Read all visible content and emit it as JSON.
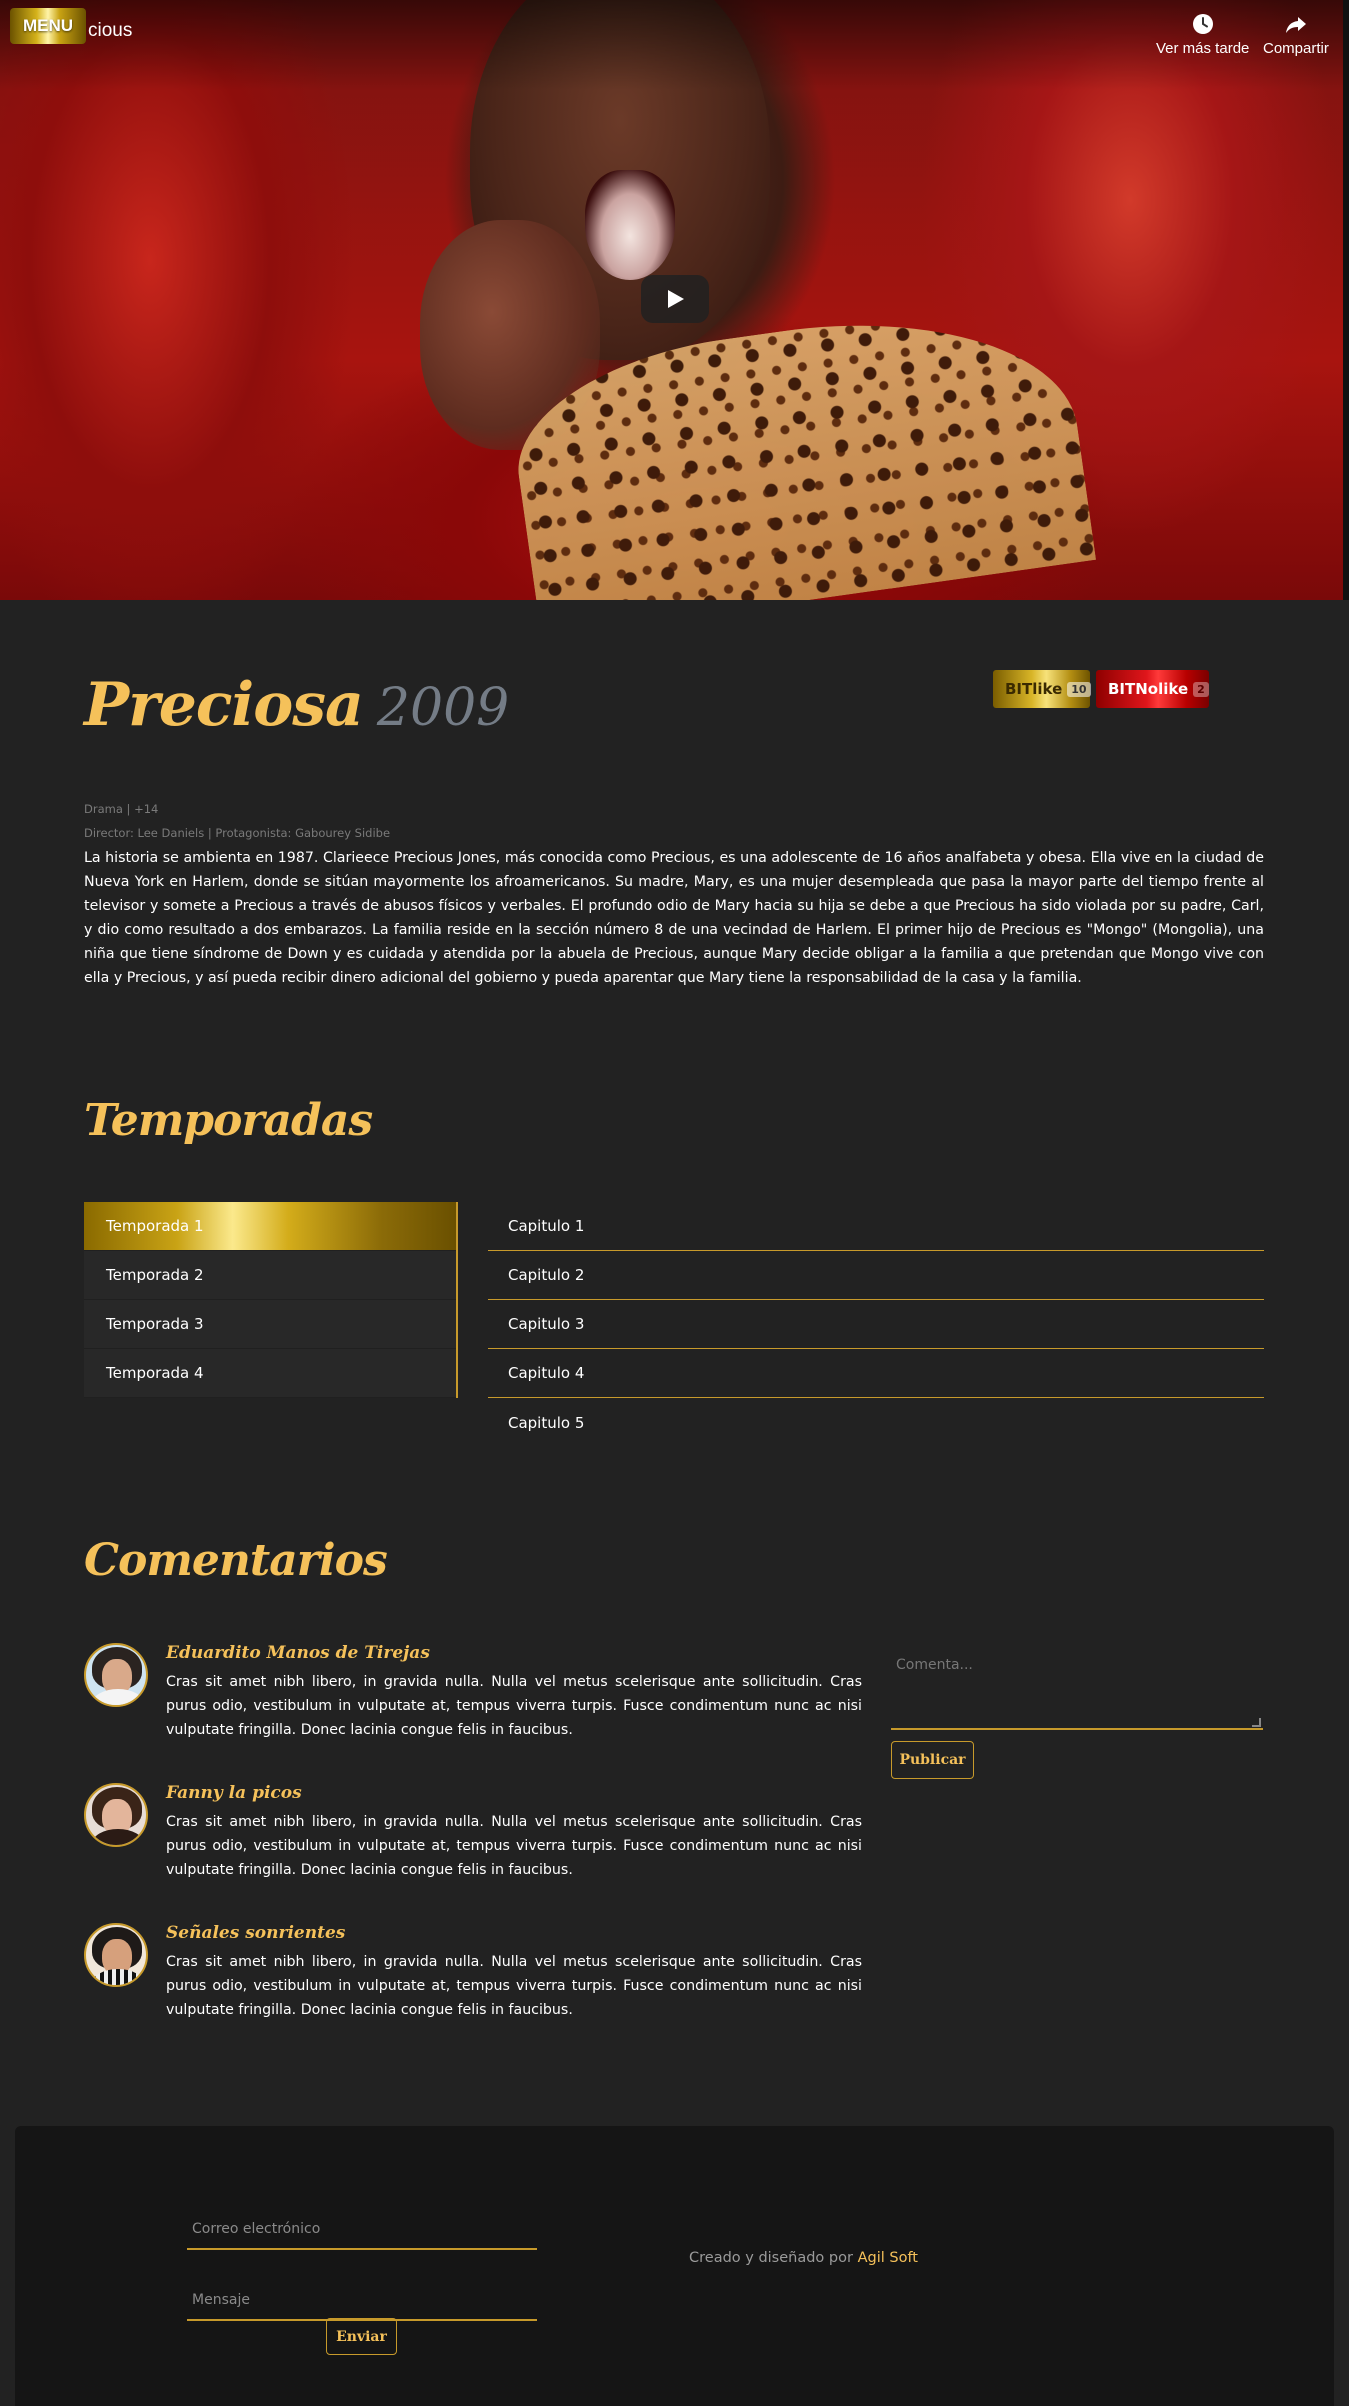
{
  "video": {
    "menu_label": "MENU",
    "title_fragment": "cious",
    "watch_later_label": "Ver más tarde",
    "share_label": "Compartir"
  },
  "movie": {
    "title": "Preciosa",
    "year": "2009",
    "genre_line": "Drama | +14",
    "credits_line": "Director: Lee Daniels | Protagonista: Gabourey Sidibe",
    "synopsis": "La historia se ambienta en 1987. Clarieece Precious Jones, más conocida como Precious, es una adolescente de 16 años analfabeta y obesa. Ella vive en la ciudad de Nueva York en Harlem, donde se sitúan mayormente los afroamericanos. Su madre, Mary, es una mujer desempleada que pasa la mayor parte del tiempo frente al televisor y somete a Precious a través de abusos físicos y verbales. El profundo odio de Mary hacia su hija se debe a que Precious ha sido violada por su padre, Carl, y dio como resultado a dos embarazos. La familia reside en la sección número 8 de una vecindad de Harlem. El primer hijo de Precious es \"Mongo\" (Mongolia), una niña que tiene síndrome de Down y es cuidada y atendida por la abuela de Precious, aunque Mary decide obligar a la familia a que pretendan que Mongo vive con ella y Precious, y así pueda recibir dinero adicional del gobierno y pueda aparentar que Mary tiene la responsabilidad de la casa y la familia."
  },
  "votes": {
    "like_label": "BITlike",
    "like_count": "10",
    "dislike_label": "BITNolike",
    "dislike_count": "2"
  },
  "seasons_section": {
    "title": "Temporadas",
    "seasons": [
      "Temporada 1",
      "Temporada 2",
      "Temporada 3",
      "Temporada 4"
    ],
    "active_season": "Temporada 1",
    "chapters": [
      "Capitulo 1",
      "Capitulo 2",
      "Capitulo 3",
      "Capitulo 4",
      "Capitulo 5"
    ]
  },
  "comments_section": {
    "title": "Comentarios",
    "comments": [
      {
        "author": "Eduardito Manos de Tirejas",
        "text": "Cras sit amet nibh libero, in gravida nulla. Nulla vel metus scelerisque ante sollicitudin. Cras purus odio, vestibulum in vulputate at, tempus viverra turpis. Fusce condimentum nunc ac nisi vulputate fringilla. Donec lacinia congue felis in faucibus."
      },
      {
        "author": "Fanny la picos",
        "text": "Cras sit amet nibh libero, in gravida nulla. Nulla vel metus scelerisque ante sollicitudin. Cras purus odio, vestibulum in vulputate at, tempus viverra turpis. Fusce condimentum nunc ac nisi vulputate fringilla. Donec lacinia congue felis in faucibus."
      },
      {
        "author": "Señales sonrientes",
        "text": "Cras sit amet nibh libero, in gravida nulla. Nulla vel metus scelerisque ante sollicitudin. Cras purus odio, vestibulum in vulputate at, tempus viverra turpis. Fusce condimentum nunc ac nisi vulputate fringilla. Donec lacinia congue felis in faucibus."
      }
    ],
    "comment_placeholder": "Comenta...",
    "publish_label": "Publicar"
  },
  "footer": {
    "email_placeholder": "Correo electrónico",
    "message_placeholder": "Mensaje",
    "send_label": "Enviar",
    "credits_prefix": "Creado y diseñado por",
    "credits_brand": "Agil Soft"
  },
  "colors": {
    "accent_gold": "#f5c15a",
    "border_gold": "#c79a2b",
    "background": "#222222",
    "footer_bg": "#151515",
    "dislike_red": "#e0161b"
  }
}
